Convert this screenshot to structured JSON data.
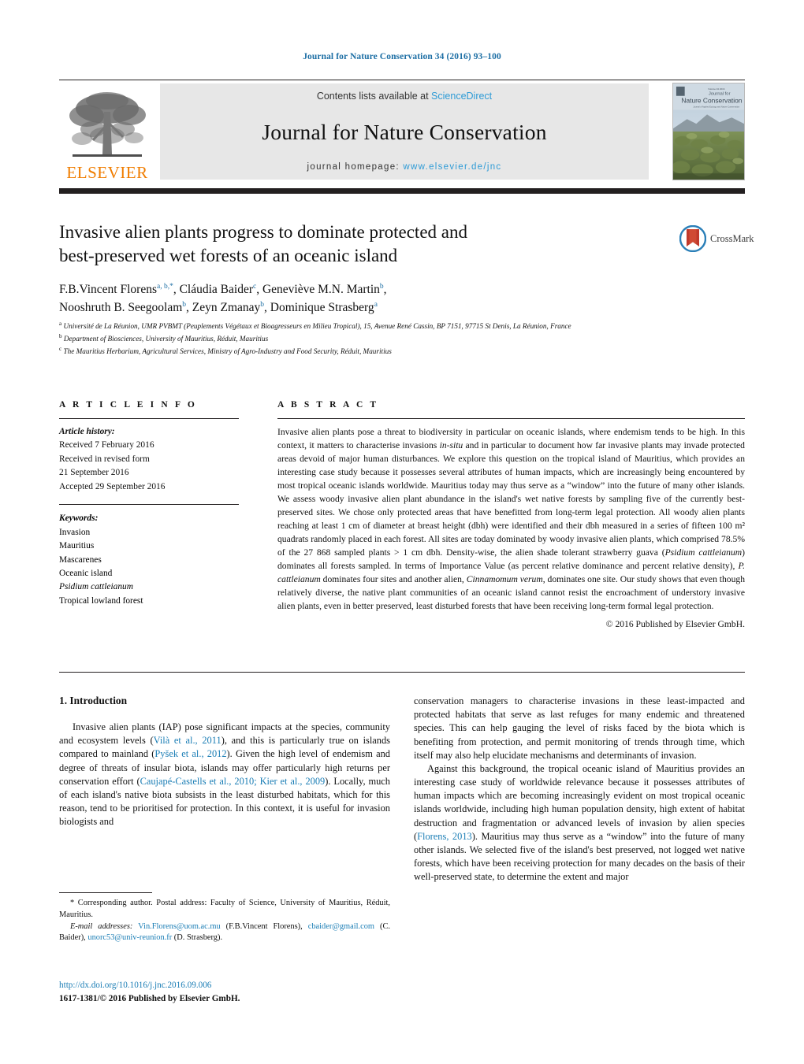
{
  "running_head": "Journal for Nature Conservation 34 (2016) 93–100",
  "masthead": {
    "publisher_logo_word": "ELSEVIER",
    "contents_prefix": "Contents lists available at ",
    "contents_link": "ScienceDirect",
    "journal_title": "Journal for Nature Conservation",
    "homepage_prefix": "journal homepage: ",
    "homepage_url": "www.elsevier.de/jnc",
    "cover_title_line1": "Journal for",
    "cover_title_line2": "Nature Conservation"
  },
  "article": {
    "title_line1": "Invasive alien plants progress to dominate protected and",
    "title_line2": "best-preserved wet forests of an oceanic island",
    "crossmark_label": "CrossMark",
    "authors_line1": "F.B.Vincent Florens",
    "authors_line1_sup": "a, b,*",
    "authors_line1_b": ", Cláudia Baider",
    "authors_line1_b_sup": "c",
    "authors_line1_c": ", Geneviève M.N. Martin",
    "authors_line1_c_sup": "b",
    "authors_line1_tail": ",",
    "authors_line2_a": "Nooshruth B. Seegoolam",
    "authors_line2_a_sup": "b",
    "authors_line2_b": ", Zeyn Zmanay",
    "authors_line2_b_sup": "b",
    "authors_line2_c": ", Dominique Strasberg",
    "authors_line2_c_sup": "a",
    "affiliations": [
      {
        "mark": "a",
        "text": "Université de La Réunion, UMR PVBMT (Peuplements Végétaux et Bioagresseurs en Milieu Tropical), 15, Avenue René Cassin, BP 7151, 97715 St Denis, La Réunion, France"
      },
      {
        "mark": "b",
        "text": "Department of Biosciences, University of Mauritius, Réduit, Mauritius"
      },
      {
        "mark": "c",
        "text": "The Mauritius Herbarium, Agricultural Services, Ministry of Agro-Industry and Food Security, Réduit, Mauritius"
      }
    ]
  },
  "article_info": {
    "heading": "A R T I C L E   I N F O",
    "history_label": "Article history:",
    "history": [
      "Received 7 February 2016",
      "Received in revised form",
      "21 September 2016",
      "Accepted 29 September 2016"
    ],
    "keywords_label": "Keywords:",
    "keywords": [
      {
        "text": "Invasion",
        "italic": false
      },
      {
        "text": "Mauritius",
        "italic": false
      },
      {
        "text": "Mascarenes",
        "italic": false
      },
      {
        "text": "Oceanic island",
        "italic": false
      },
      {
        "text": "Psidium cattleianum",
        "italic": true
      },
      {
        "text": "Tropical lowland forest",
        "italic": false
      }
    ]
  },
  "abstract": {
    "heading": "A B S T R A C T",
    "p1": "Invasive alien plants pose a threat to biodiversity in particular on oceanic islands, where endemism tends to be high. In this context, it matters to characterise invasions ",
    "i1": "in-situ",
    "p2": " and in particular to document how far invasive plants may invade protected areas devoid of major human disturbances. We explore this question on the tropical island of Mauritius, which provides an interesting case study because it possesses several attributes of human impacts, which are increasingly being encountered by most tropical oceanic islands worldwide. Mauritius today may thus serve as a “window” into the future of many other islands. We assess woody invasive alien plant abundance in the island's wet native forests by sampling five of the currently best-preserved sites. We chose only protected areas that have benefitted from long-term legal protection. All woody alien plants reaching at least 1 cm of diameter at breast height (dbh) were identified and their dbh measured in a series of fifteen 100 m² quadrats randomly placed in each forest. All sites are today dominated by woody invasive alien plants, which comprised 78.5% of the 27 868 sampled plants > 1 cm dbh. Density-wise, the alien shade tolerant strawberry guava (",
    "i2": "Psidium cattleianum",
    "p3": ") dominates all forests sampled. In terms of Importance Value (as percent relative dominance and percent relative density), ",
    "i3": "P. cattleianum",
    "p4": " dominates four sites and another alien, ",
    "i4": "Cinnamomum verum",
    "p5": ", dominates one site. Our study shows that even though relatively diverse, the native plant communities of an oceanic island cannot resist the encroachment of understory invasive alien plants, even in better preserved, least disturbed forests that have been receiving long-term formal legal protection.",
    "copyright": "© 2016 Published by Elsevier GmbH."
  },
  "body": {
    "section_heading": "1.  Introduction",
    "left_p1_a": "Invasive alien plants (IAP) pose significant impacts at the species, community and ecosystem levels (",
    "left_ref1": "Vilà et al., 2011",
    "left_p1_b": "), and this is particularly true on islands compared to mainland (",
    "left_ref2": "Pyšek et al., 2012",
    "left_p1_c": "). Given the high level of endemism and degree of threats of insular biota, islands may offer particularly high returns per conservation effort (",
    "left_ref3": "Caujapé-Castells et al., 2010; Kier et al., 2009",
    "left_p1_d": "). Locally, much of each island's native biota subsists in the least disturbed habitats, which for this reason, tend to be prioritised for protection. In this context, it is useful for invasion biologists and",
    "right_p1": "conservation managers to characterise invasions in these least-impacted and protected habitats that serve as last refuges for many endemic and threatened species. This can help gauging the level of risks faced by the biota which is benefiting from protection, and permit monitoring of trends through time, which itself may also help elucidate mechanisms and determinants of invasion.",
    "right_p2_a": "Against this background, the tropical oceanic island of Mauritius provides an interesting case study of worldwide relevance because it possesses attributes of human impacts which are becoming increasingly evident on most tropical oceanic islands worldwide, including high human population density, high extent of habitat destruction and fragmentation or advanced levels of invasion by alien species (",
    "right_ref1": "Florens, 2013",
    "right_p2_b": "). Mauritius may thus serve as a “window” into the future of many other islands. We selected five of the island's best preserved, not logged wet native forests, which have been receiving protection for many decades on the basis of their well-preserved state, to determine the extent and major"
  },
  "footnotes": {
    "corresponding": "*  Corresponding author. Postal address: Faculty of Science, University of Mauritius, Réduit, Mauritius.",
    "email_label": "E-mail addresses:",
    "email1": "Vin.Florens@uom.ac.mu",
    "email1_name": " (F.B.Vincent Florens),",
    "email2": "cbaider@gmail.com",
    "email2_name": " (C. Baider),",
    "email3": "unorc53@univ-reunion.fr",
    "email3_name": " (D. Strasberg).",
    "doi_url": "http://dx.doi.org/10.1016/j.jnc.2016.09.006",
    "issn_line": "1617-1381/© 2016 Published by Elsevier GmbH."
  },
  "colors": {
    "link": "#1a7db5",
    "header_blue": "#1c6ea4",
    "sciencedirect": "#2e9bd6",
    "elsevier_orange": "#f07d00",
    "rule": "#231f20",
    "band_bg": "#e7e7e7"
  }
}
